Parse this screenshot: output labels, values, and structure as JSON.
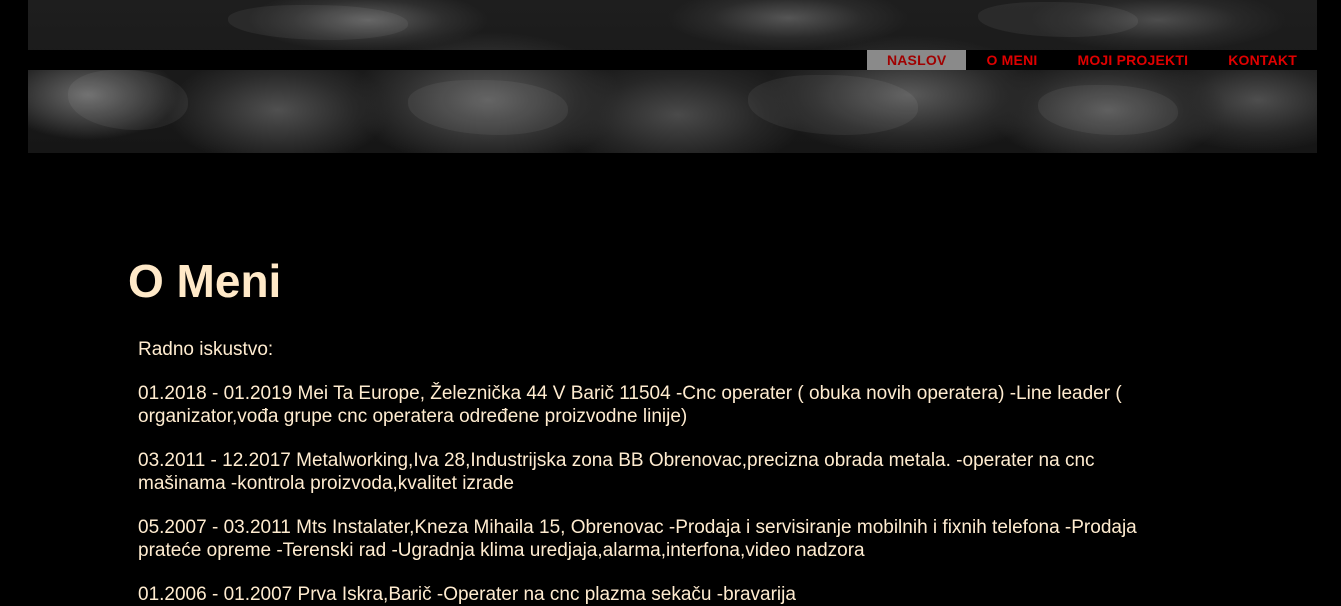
{
  "nav": {
    "items": [
      {
        "label": "NASLOV",
        "active": true
      },
      {
        "label": "O MENI",
        "active": false
      },
      {
        "label": "MOJI PROJEKTI",
        "active": false
      },
      {
        "label": "KONTAKT",
        "active": false
      }
    ]
  },
  "main": {
    "title": "O Meni",
    "paragraphs": [
      "Radno iskustvo:",
      "01.2018 - 01.2019 Mei Ta Europe, Železnička 44 V Barič 11504 -Cnc operater ( obuka novih operatera) -Line leader ( organizator,vođa grupe cnc operatera određene proizvodne linije)",
      "03.2011 - 12.2017 Metalworking,Iva 28,Industrijska zona BB Obrenovac,precizna obrada metala. -operater na cnc mašinama -kontrola proizvoda,kvalitet izrade",
      "05.2007 - 03.2011 Mts Instalater,Kneza Mihaila 15, Obrenovac -Prodaja i servisiranje mobilnih i fixnih telefona -Prodaja prateće opreme -Terenski rad -Ugradnja klima uredjaja,alarma,interfona,video nadzora",
      "01.2006 - 01.2007 Prva Iskra,Barič -Operater na cnc plazma sekaču -bravarija"
    ]
  },
  "colors": {
    "background": "#000000",
    "nav_text": "#e00000",
    "nav_active_bg": "#8a8a8a",
    "title": "#ffe9c8",
    "body_text": "#ffecd0"
  }
}
